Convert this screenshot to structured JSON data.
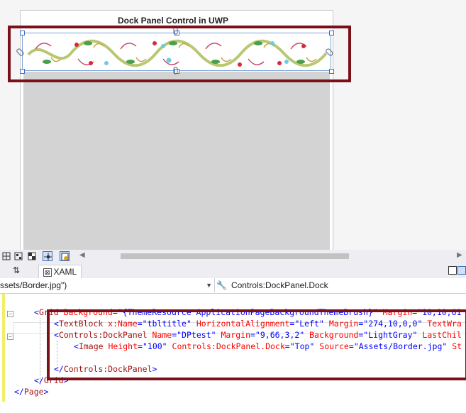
{
  "designer": {
    "page_title": "Dock Panel Control in UWP"
  },
  "tabs": {
    "swap_label": "⇅",
    "xaml_label": "XAML"
  },
  "navbar": {
    "left_text": "ssets/Border.jpg\")",
    "right_text": "Controls:DockPanel.Dock"
  },
  "code_lines": [
    [
      {
        "t": "<",
        "c": "blue"
      },
      {
        "t": "Grid",
        "c": "brown"
      },
      {
        "t": " ",
        "c": "blue"
      },
      {
        "t": "Background",
        "c": "red"
      },
      {
        "t": "=\"",
        "c": "blue"
      },
      {
        "t": "{ThemeResource ApplicationPageBackgroundThemeBrush}",
        "c": "blue"
      },
      {
        "t": "\"",
        "c": "blue"
      },
      {
        "t": " Margin",
        "c": "red"
      },
      {
        "t": "=\"",
        "c": "blue"
      },
      {
        "t": "10,10,61",
        "c": "blue"
      }
    ],
    [
      {
        "t": "<",
        "c": "blue"
      },
      {
        "t": "TextBlock",
        "c": "brown"
      },
      {
        "t": " x:Name",
        "c": "red"
      },
      {
        "t": "=\"",
        "c": "blue"
      },
      {
        "t": "tbltitle",
        "c": "blue"
      },
      {
        "t": "\"",
        "c": "blue"
      },
      {
        "t": " HorizontalAlignment",
        "c": "red"
      },
      {
        "t": "=\"",
        "c": "blue"
      },
      {
        "t": "Left",
        "c": "blue"
      },
      {
        "t": "\"",
        "c": "blue"
      },
      {
        "t": " Margin",
        "c": "red"
      },
      {
        "t": "=\"",
        "c": "blue"
      },
      {
        "t": "274,10,0,0",
        "c": "blue"
      },
      {
        "t": "\"",
        "c": "blue"
      },
      {
        "t": " TextWra",
        "c": "red"
      }
    ],
    [
      {
        "t": "<",
        "c": "blue"
      },
      {
        "t": "Controls:DockPanel",
        "c": "brown"
      },
      {
        "t": " Name",
        "c": "red"
      },
      {
        "t": "=\"",
        "c": "blue"
      },
      {
        "t": "DPtest",
        "c": "blue"
      },
      {
        "t": "\"",
        "c": "blue"
      },
      {
        "t": " Margin",
        "c": "red"
      },
      {
        "t": "=\"",
        "c": "blue"
      },
      {
        "t": "9,66,3,2",
        "c": "blue"
      },
      {
        "t": "\"",
        "c": "blue"
      },
      {
        "t": " Background",
        "c": "red"
      },
      {
        "t": "=\"",
        "c": "blue"
      },
      {
        "t": "LightGray",
        "c": "blue"
      },
      {
        "t": "\"",
        "c": "blue"
      },
      {
        "t": " LastChil",
        "c": "red"
      }
    ],
    [
      {
        "t": "<",
        "c": "blue"
      },
      {
        "t": "Image",
        "c": "brown"
      },
      {
        "t": " Height",
        "c": "red"
      },
      {
        "t": "=\"",
        "c": "blue"
      },
      {
        "t": "100",
        "c": "blue"
      },
      {
        "t": "\"",
        "c": "blue"
      },
      {
        "t": " Controls:DockPanel.Dock",
        "c": "red"
      },
      {
        "t": "=\"",
        "c": "blue"
      },
      {
        "t": "Top",
        "c": "blue"
      },
      {
        "t": "\"",
        "c": "blue"
      },
      {
        "t": " Source",
        "c": "red"
      },
      {
        "t": "=\"",
        "c": "blue"
      },
      {
        "t": "Assets/Border.jpg",
        "c": "blue"
      },
      {
        "t": "\"",
        "c": "blue"
      },
      {
        "t": " St",
        "c": "red"
      }
    ],
    [],
    [
      {
        "t": "</",
        "c": "blue"
      },
      {
        "t": "Controls:DockPanel",
        "c": "brown"
      },
      {
        "t": ">",
        "c": "blue"
      }
    ],
    [
      {
        "t": "</",
        "c": "blue"
      },
      {
        "t": "Grid",
        "c": "brown"
      },
      {
        "t": ">",
        "c": "blue"
      }
    ],
    [
      {
        "t": "</",
        "c": "blue"
      },
      {
        "t": "Page",
        "c": "brown"
      },
      {
        "t": ">",
        "c": "blue"
      }
    ]
  ],
  "colors": {
    "highlight_box": "#7b1019",
    "dock_panel_bg": "#d3d3d3",
    "xml_tag": "#a31515",
    "xml_attr": "#ff0000",
    "xml_value": "#0000ff"
  }
}
